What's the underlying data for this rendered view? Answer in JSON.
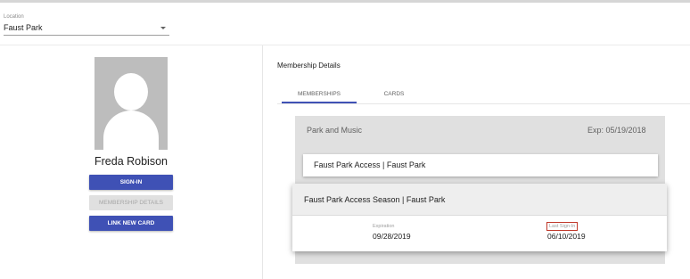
{
  "location": {
    "label": "Location",
    "value": "Faust Park"
  },
  "member": {
    "name": "Freda Robison",
    "buttons": {
      "sign_in": "SIGN-IN",
      "membership_details": "MEMBERSHIP DETAILS",
      "link_new_card": "LINK NEW CARD"
    }
  },
  "details": {
    "title": "Membership Details",
    "tabs": [
      {
        "label": "MEMBERSHIPS",
        "active": true
      },
      {
        "label": "CARDS",
        "active": false
      }
    ],
    "membership": {
      "name": "Park and Music",
      "expiration": "Exp: 05/19/2018",
      "cards": [
        {
          "title": "Faust Park Access | Faust Park"
        },
        {
          "title": "Faust Park Access Season | Faust Park",
          "expiration_label": "Expiration",
          "expiration_value": "09/28/2019",
          "last_signin_label": "Last Sign-In",
          "last_signin_value": "06/10/2019"
        }
      ]
    }
  },
  "colors": {
    "primary": "#3f51b5",
    "avatar_bg": "#bdbdbd",
    "panel_bg": "#e0e0e0",
    "highlight_border": "#c0392b"
  },
  "icons": {
    "avatar": "person-placeholder-icon",
    "dropdown": "caret-down-icon"
  }
}
